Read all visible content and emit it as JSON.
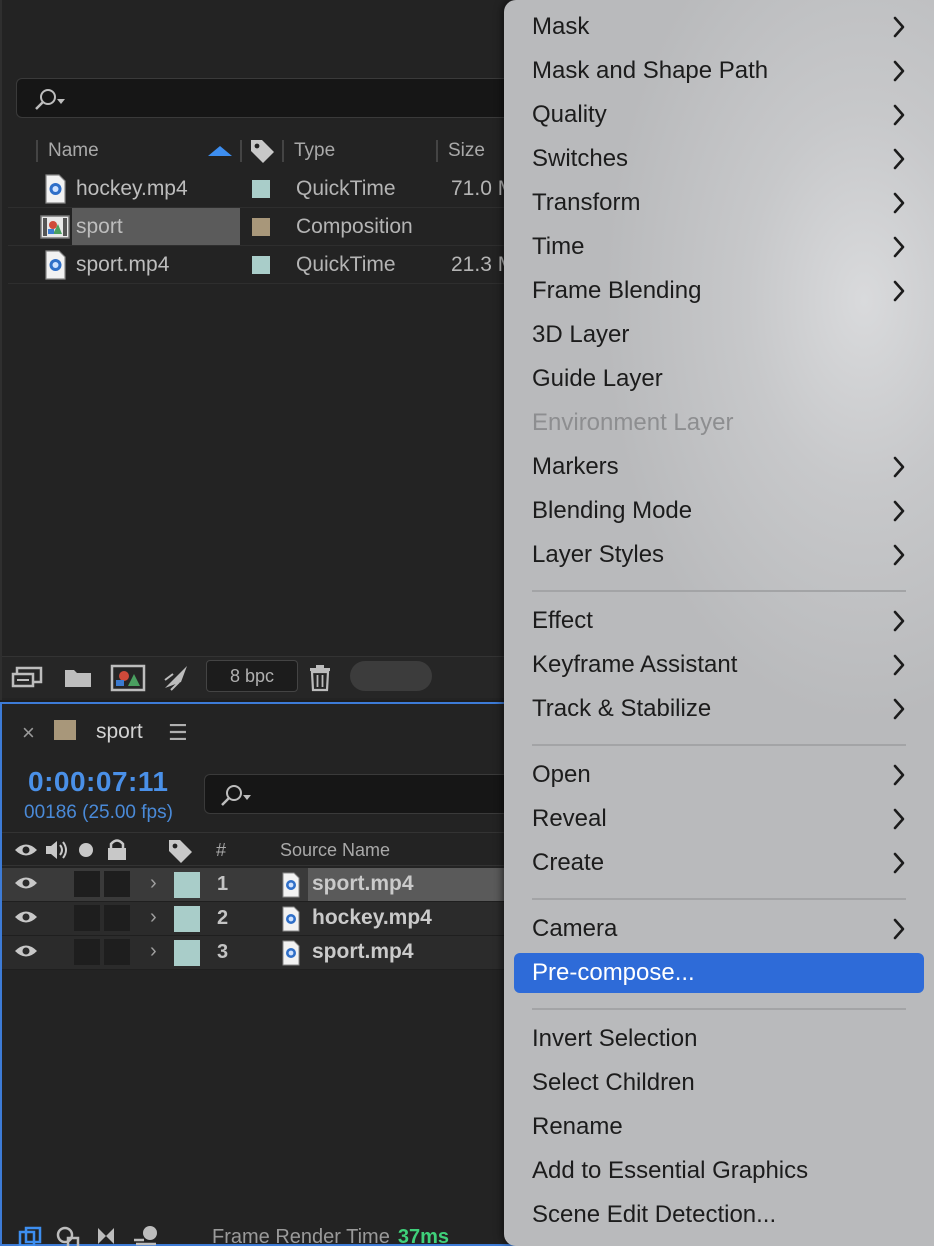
{
  "project_panel": {
    "columns": {
      "name": "Name",
      "type": "Type",
      "size": "Size"
    },
    "items": [
      {
        "name": "hockey.mp4",
        "type": "QuickTime",
        "size": "71.0 M",
        "label_color": "#a9cdc9",
        "icon": "video-file-icon",
        "selected": false
      },
      {
        "name": "sport",
        "type": "Composition",
        "size": "",
        "label_color": "#a8977a",
        "icon": "composition-icon",
        "selected": true
      },
      {
        "name": "sport.mp4",
        "type": "QuickTime",
        "size": "21.3 M",
        "label_color": "#a9cdc9",
        "icon": "video-file-icon",
        "selected": false
      }
    ],
    "footer": {
      "bpc": "8 bpc"
    }
  },
  "timeline": {
    "tab_name": "sport",
    "timecode": "0:00:07:11",
    "frames": "00186 (25.00 fps)",
    "headers": {
      "number": "#",
      "source_name": "Source Name"
    },
    "layers": [
      {
        "num": "1",
        "name": "sport.mp4",
        "selected": true
      },
      {
        "num": "2",
        "name": "hockey.mp4",
        "selected": false
      },
      {
        "num": "3",
        "name": "sport.mp4",
        "selected": false
      }
    ],
    "render_label": "Frame Render Time",
    "render_value": "37ms"
  },
  "context_menu": {
    "items": [
      {
        "label": "Mask",
        "submenu": true
      },
      {
        "label": "Mask and Shape Path",
        "submenu": true
      },
      {
        "label": "Quality",
        "submenu": true
      },
      {
        "label": "Switches",
        "submenu": true
      },
      {
        "label": "Transform",
        "submenu": true
      },
      {
        "label": "Time",
        "submenu": true
      },
      {
        "label": "Frame Blending",
        "submenu": true
      },
      {
        "label": "3D Layer",
        "submenu": false
      },
      {
        "label": "Guide Layer",
        "submenu": false
      },
      {
        "label": "Environment Layer",
        "submenu": false,
        "disabled": true
      },
      {
        "label": "Markers",
        "submenu": true
      },
      {
        "label": "Blending Mode",
        "submenu": true
      },
      {
        "label": "Layer Styles",
        "submenu": true
      },
      {
        "separator": true
      },
      {
        "label": "Effect",
        "submenu": true
      },
      {
        "label": "Keyframe Assistant",
        "submenu": true
      },
      {
        "label": "Track & Stabilize",
        "submenu": true
      },
      {
        "separator": true
      },
      {
        "label": "Open",
        "submenu": true
      },
      {
        "label": "Reveal",
        "submenu": true
      },
      {
        "label": "Create",
        "submenu": true
      },
      {
        "separator": true
      },
      {
        "label": "Camera",
        "submenu": true
      },
      {
        "label": "Pre-compose...",
        "submenu": false,
        "active": true
      },
      {
        "separator": true
      },
      {
        "label": "Invert Selection",
        "submenu": false
      },
      {
        "label": "Select Children",
        "submenu": false
      },
      {
        "label": "Rename",
        "submenu": false
      },
      {
        "label": "Add to Essential Graphics",
        "submenu": false
      },
      {
        "label": "Scene Edit Detection...",
        "submenu": false
      }
    ]
  }
}
